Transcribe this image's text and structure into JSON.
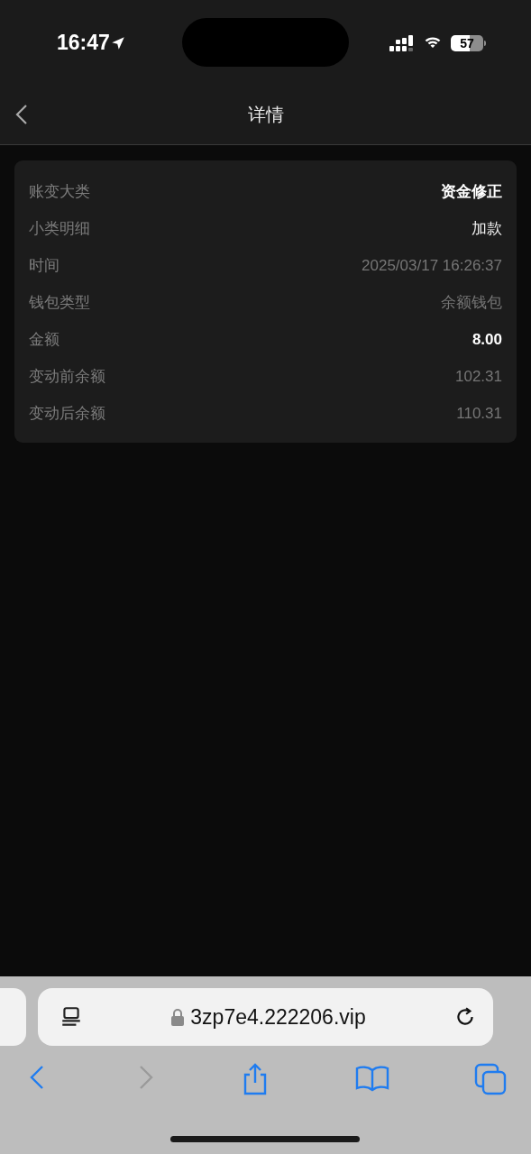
{
  "status_bar": {
    "time": "16:47",
    "battery": "57"
  },
  "nav": {
    "title": "详情"
  },
  "details": [
    {
      "label": "账变大类",
      "value": "资金修正",
      "kind": "strong"
    },
    {
      "label": "小类明细",
      "value": "加款",
      "kind": "normal"
    },
    {
      "label": "时间",
      "value": "2025/03/17 16:26:37",
      "kind": "muted"
    },
    {
      "label": "钱包类型",
      "value": "余额钱包",
      "kind": "muted"
    },
    {
      "label": "金额",
      "value": "8.00",
      "kind": "strong"
    },
    {
      "label": "变动前余额",
      "value": "102.31",
      "kind": "muted"
    },
    {
      "label": "变动后余额",
      "value": "110.31",
      "kind": "muted"
    }
  ],
  "browser": {
    "url": "3zp7e4.222206.vip",
    "back_disabled": false,
    "forward_disabled": true
  }
}
